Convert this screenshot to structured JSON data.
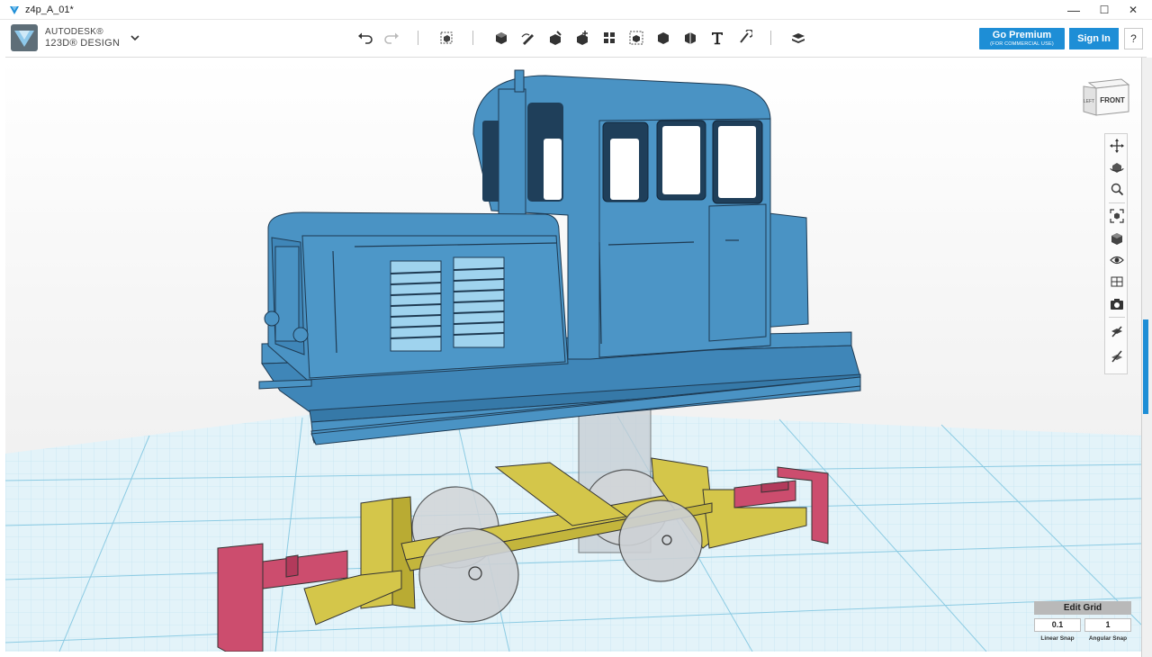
{
  "window": {
    "title": "z4p_A_01*",
    "controls": {
      "minimize": "—",
      "maximize": "☐",
      "close": "✕"
    }
  },
  "brand": {
    "line1": "AUTODESK®",
    "line2": "123D® DESIGN",
    "icon": "autodesk-logo-icon"
  },
  "toolbar": {
    "buttons": [
      "undo-icon",
      "redo-icon",
      "transform-icon",
      "primitives-icon",
      "sketch-icon",
      "construct-icon",
      "modify-icon",
      "pattern-icon",
      "group-icon",
      "combine-icon",
      "measure-icon",
      "text-icon",
      "snap-icon",
      "material-icon"
    ],
    "premium_label": "Go Premium",
    "premium_sub": "(FOR COMMERCIAL USE)",
    "signin_label": "Sign In",
    "help_label": "?"
  },
  "viewcube": {
    "face_label": "FRONT",
    "side_label": "LEFT"
  },
  "nav": {
    "buttons": [
      "pan-icon",
      "orbit-icon",
      "zoom-icon",
      "fit-icon",
      "view-icon",
      "visibility-icon",
      "material-view-icon",
      "camera-icon",
      "grid-icon",
      "snap-view-icon"
    ]
  },
  "edit_grid": {
    "title": "Edit Grid",
    "linear_value": "0.1",
    "angular_value": "1",
    "linear_label": "Linear Snap",
    "angular_label": "Angular Snap"
  },
  "colors": {
    "accent": "#1e8ed6",
    "body_blue": "#4a93c4",
    "frame_yellow": "#d4c64a",
    "buffer_pink": "#cc4d6e",
    "grid_blue": "#a8d6e8"
  }
}
